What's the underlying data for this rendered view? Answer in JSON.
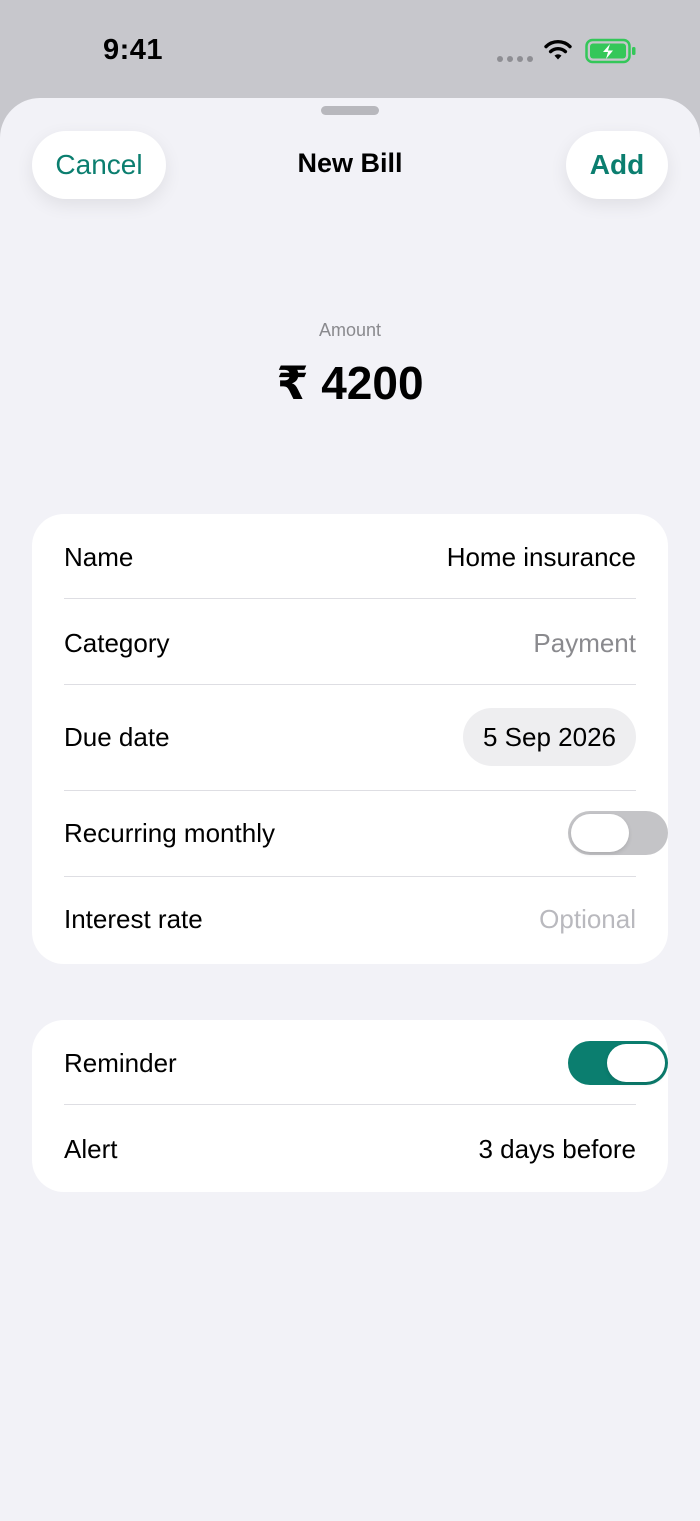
{
  "status_bar": {
    "time": "9:41"
  },
  "header": {
    "cancel_label": "Cancel",
    "title": "New Bill",
    "add_label": "Add"
  },
  "amount": {
    "label": "Amount",
    "value": "₹ 4200"
  },
  "details": {
    "name": {
      "label": "Name",
      "value": "Home insurance"
    },
    "category": {
      "label": "Category",
      "value": "Payment"
    },
    "due_date": {
      "label": "Due date",
      "value": "5 Sep 2026"
    },
    "recurring": {
      "label": "Recurring monthly",
      "on": false
    },
    "interest": {
      "label": "Interest rate",
      "placeholder": "Optional"
    }
  },
  "reminder": {
    "toggle": {
      "label": "Reminder",
      "on": true
    },
    "alert": {
      "label": "Alert",
      "value": "3 days before"
    }
  },
  "colors": {
    "accent": "#0b7e6f",
    "battery": "#34c759"
  }
}
